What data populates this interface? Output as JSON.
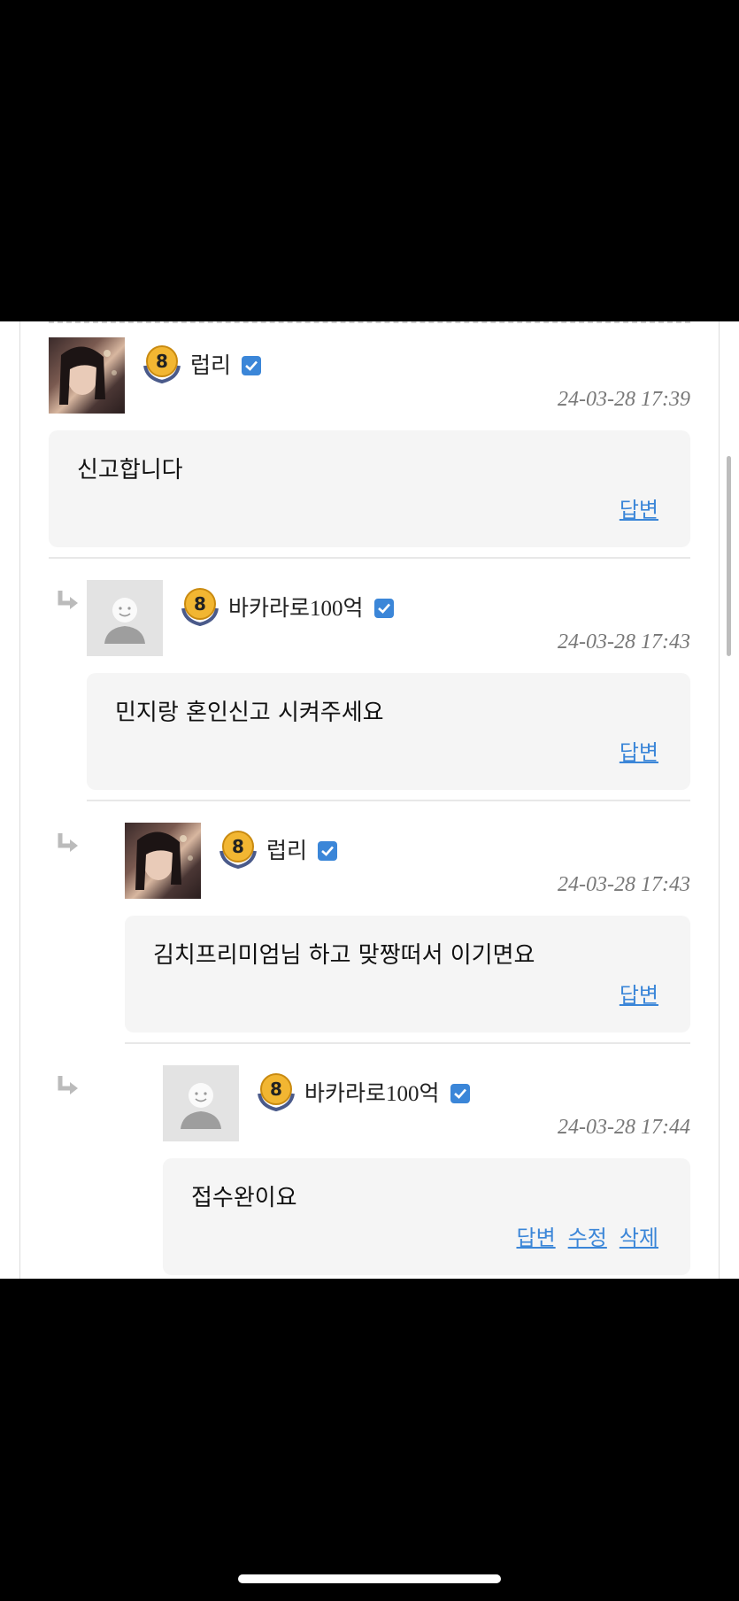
{
  "comments": [
    {
      "nickname": "럽리",
      "level": "8",
      "avatar": "photo",
      "timestamp": "24-03-28 17:39",
      "text": "신고합니다",
      "actions": [
        "답변"
      ]
    },
    {
      "nickname": "바카라로100억",
      "level": "8",
      "avatar": "default-user",
      "timestamp": "24-03-28 17:43",
      "text": "민지랑 혼인신고 시켜주세요",
      "actions": [
        "답변"
      ]
    },
    {
      "nickname": "럽리",
      "level": "8",
      "avatar": "photo",
      "timestamp": "24-03-28 17:43",
      "text": "김치프리미엄님 하고 맞짱떠서 이기면요",
      "actions": [
        "답변"
      ]
    },
    {
      "nickname": "바카라로100억",
      "level": "8",
      "avatar": "default-user",
      "timestamp": "24-03-28 17:44",
      "text": "접수완이요",
      "actions": [
        "답변",
        "수정",
        "삭제"
      ]
    }
  ],
  "icons": {
    "verified": "check-square-icon",
    "reply": "reply-arrow-icon",
    "level": "level-badge-icon"
  },
  "colors": {
    "link": "#3b86d8",
    "verified": "#3b86d8",
    "bubble": "#f5f5f5",
    "timestamp": "#777777"
  }
}
